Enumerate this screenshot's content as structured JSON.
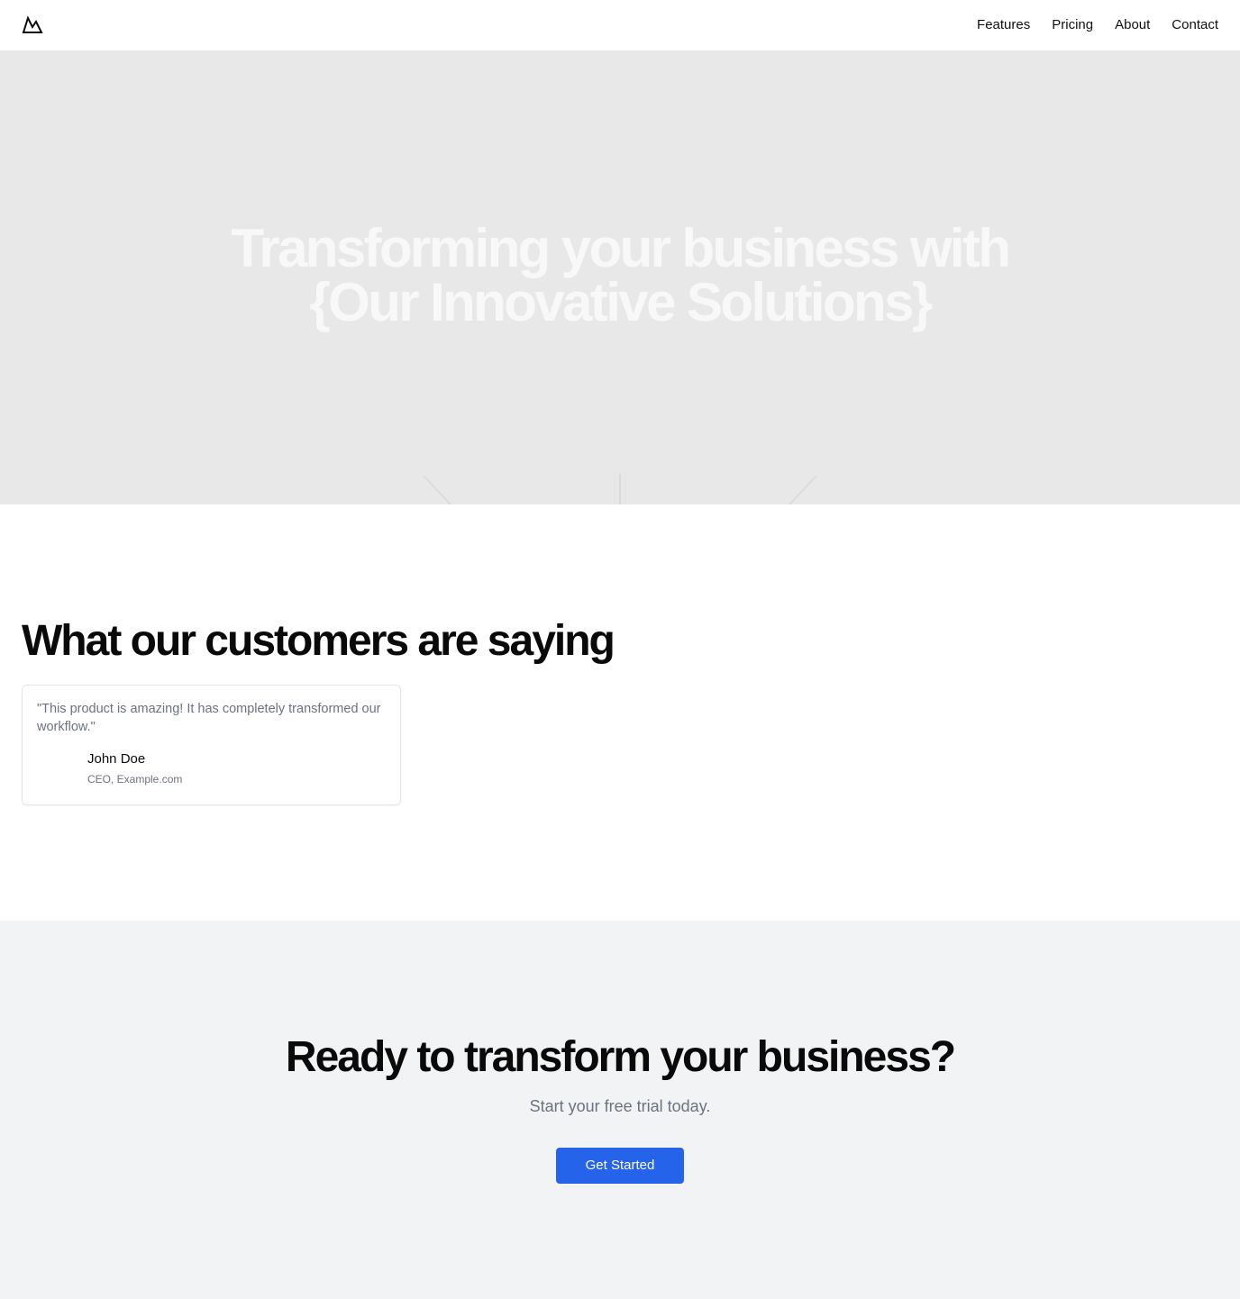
{
  "header": {
    "logo_icon": "mountain-logo-icon",
    "nav": [
      {
        "label": "Features"
      },
      {
        "label": "Pricing"
      },
      {
        "label": "About"
      },
      {
        "label": "Contact"
      }
    ]
  },
  "hero": {
    "title_line1": "Transforming your business with",
    "title_line2": "{Our Innovative Solutions}",
    "background_color": "#e8e8e8"
  },
  "testimonials": {
    "title": "What our customers are saying",
    "items": [
      {
        "quote": "\"This product is amazing! It has completely transformed our workflow.\"",
        "name": "John Doe",
        "role": "CEO, Example.com"
      }
    ]
  },
  "cta": {
    "title": "Ready to transform your business?",
    "subtitle": "Start your free trial today.",
    "button_label": "Get Started",
    "button_color": "#2563eb"
  }
}
